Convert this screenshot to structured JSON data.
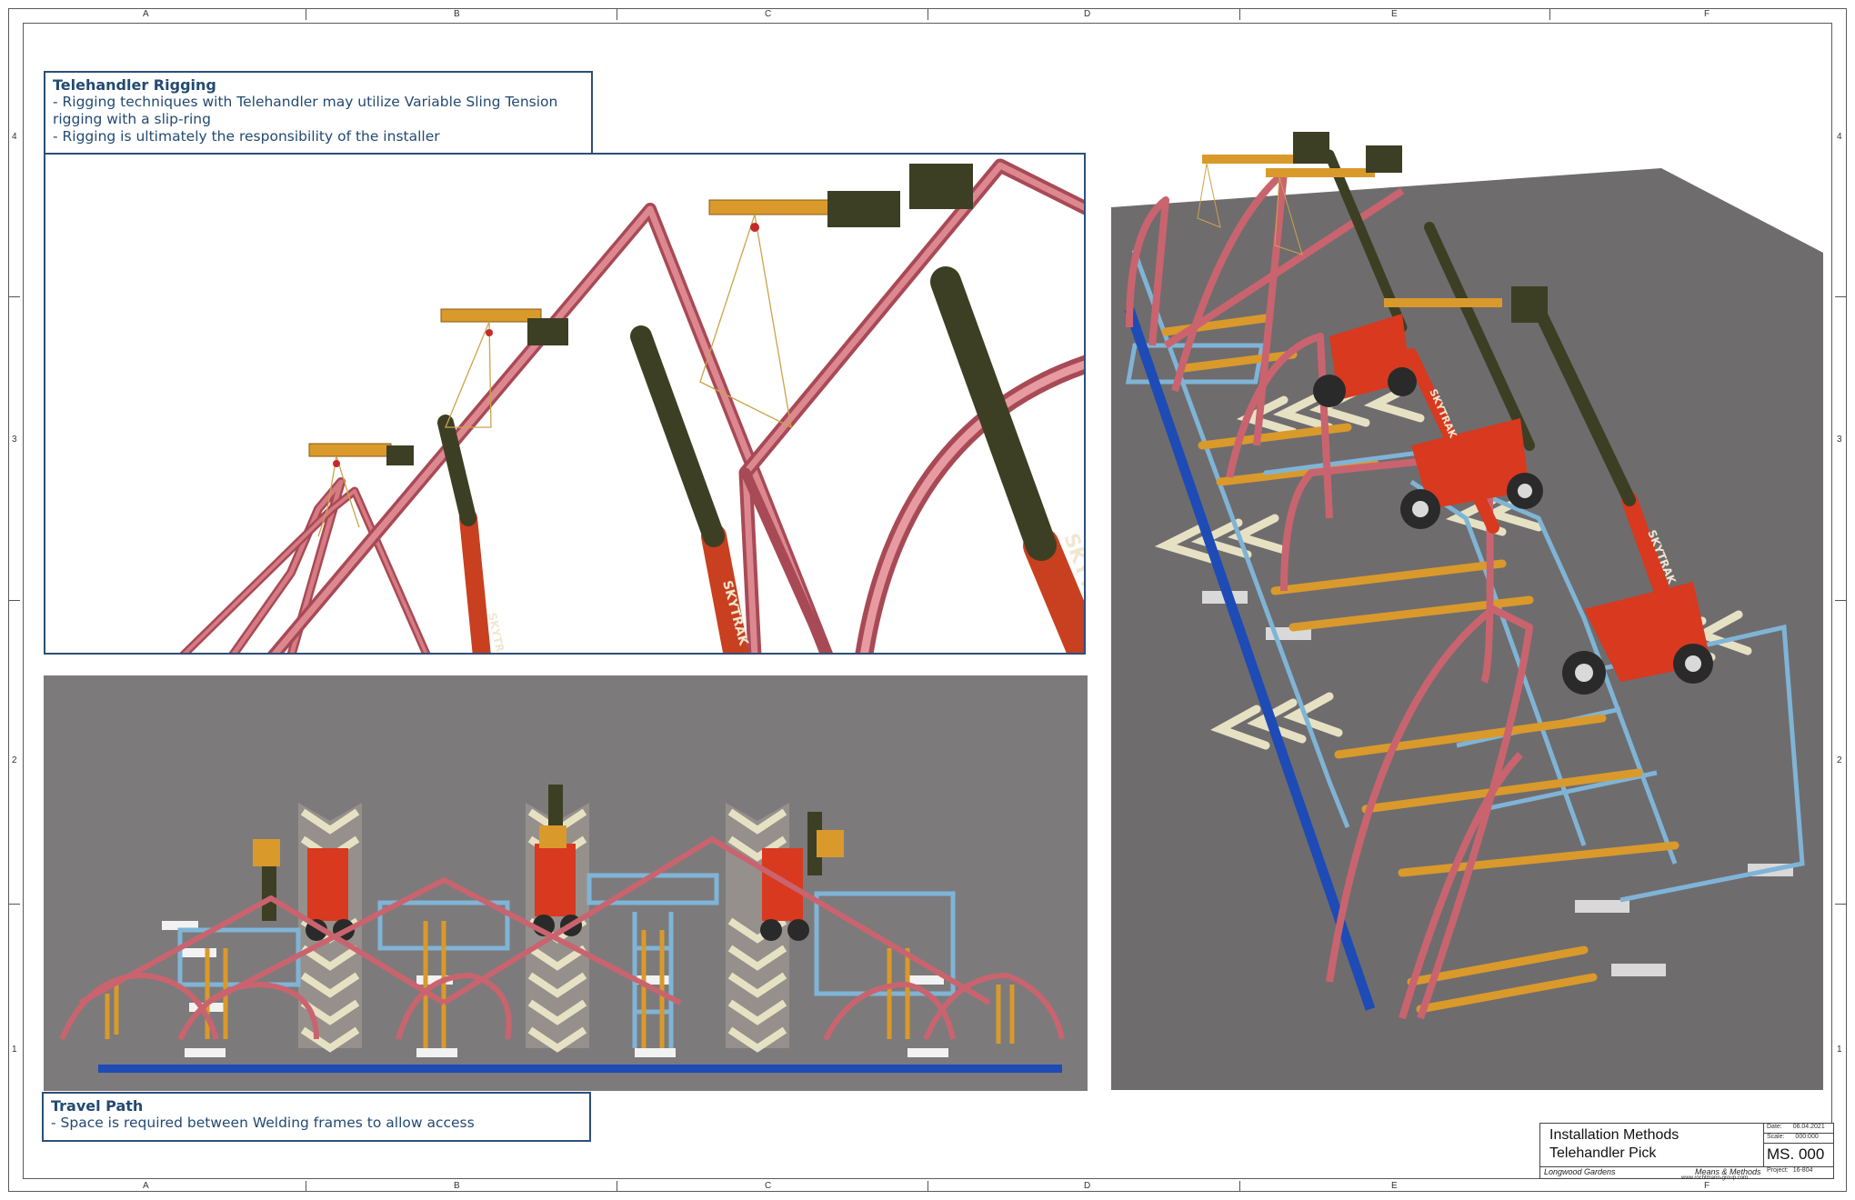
{
  "border": {
    "columns": [
      "A",
      "B",
      "C",
      "D",
      "E",
      "F"
    ],
    "rows": [
      "4",
      "3",
      "2",
      "1"
    ]
  },
  "rigging_note": {
    "title": "Telehandler Rigging",
    "lines": [
      "- Rigging techniques with Telehandler may utilize Variable Sling Tension",
      "rigging with a slip-ring",
      "- Rigging is ultimately the responsibility of the installer"
    ]
  },
  "travel_note": {
    "title": "Travel Path",
    "lines": [
      "- Space is required between Welding frames to allow access"
    ]
  },
  "renders": {
    "boom_label": "SKYTRAK"
  },
  "title_block": {
    "title_line1": "Installation Methods",
    "title_line2": "Telehandler Pick",
    "date_label": "Date:",
    "date_value": "06.04.2021",
    "scale_label": "Scale:",
    "scale_value": "000:000",
    "sheet_number": "MS. 000",
    "project_label": "Project:",
    "project_value": "16-804",
    "client": "Longwood Gardens",
    "category": "Means & Methods",
    "website": "www.rochtmann-group.com"
  },
  "colors": {
    "note_border": "#2c4f78",
    "note_text": "#234a72",
    "frame_pink": "#c9646f",
    "boom_dark": "#3d3f24",
    "telehandler_red": "#d8391f",
    "spreader_orange": "#d99a2b",
    "steel_blue": "#7fb4d6",
    "rail_blue": "#1e4bb5",
    "floor_gray": "#7d7a7c",
    "chevron_cream": "#e7e1c4"
  }
}
